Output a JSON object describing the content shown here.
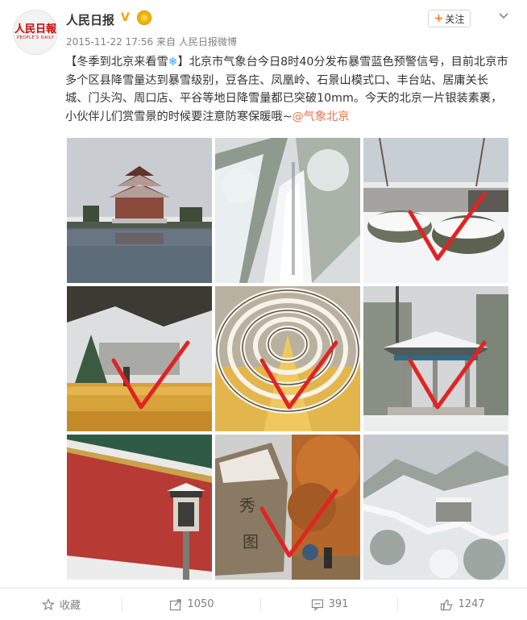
{
  "account": {
    "name": "人民日报",
    "logo_text": "人民日報",
    "logo_subtext": "PEOPLE'S DAILY",
    "verified_icon": "verified-v-icon",
    "medal_icon": "member-medal-icon"
  },
  "meta": {
    "timestamp": "2015-11-22 17:56",
    "source_prefix": "来自",
    "source": "人民日报微博"
  },
  "follow": {
    "label": "关注"
  },
  "post": {
    "title": "【冬季到北京来看雪",
    "title_end": "】",
    "body": "北京市气象台今日8时40分发布暴雪蓝色预警信号，目前北京市多个区县降雪量达到暴雪级别，豆各庄、凤凰岭、石景山模式口、丰台站、居庸关长城、门头沟、周口店、平谷等地日降雪量都已突破10mm。今天的北京一片银装素裹，小伙伴儿们赏雪景的时候要注意防寒保暖哦~",
    "mention": "@气象北京"
  },
  "photos": [
    {
      "subject": "corner-tower",
      "checked": false
    },
    {
      "subject": "snowy-great-wall",
      "checked": false
    },
    {
      "subject": "snowy-garden",
      "checked": true
    },
    {
      "subject": "ginkgo-leaves",
      "checked": true
    },
    {
      "subject": "arched-trellis",
      "checked": true
    },
    {
      "subject": "pavilion",
      "checked": true
    },
    {
      "subject": "red-wall-lantern",
      "checked": false
    },
    {
      "subject": "inscribed-rock",
      "checked": true
    },
    {
      "subject": "snowy-mountain-wall",
      "checked": false
    }
  ],
  "actions": {
    "favorite": {
      "label": "收藏",
      "icon": "star-icon"
    },
    "repost": {
      "count": "1050",
      "icon": "repost-icon"
    },
    "comment": {
      "count": "391",
      "icon": "comment-icon"
    },
    "like": {
      "count": "1247",
      "icon": "thumbs-up-icon"
    }
  },
  "colors": {
    "link": "#eb7350",
    "accent": "#ff8200",
    "check": "#e02424",
    "muted": "#808080"
  }
}
